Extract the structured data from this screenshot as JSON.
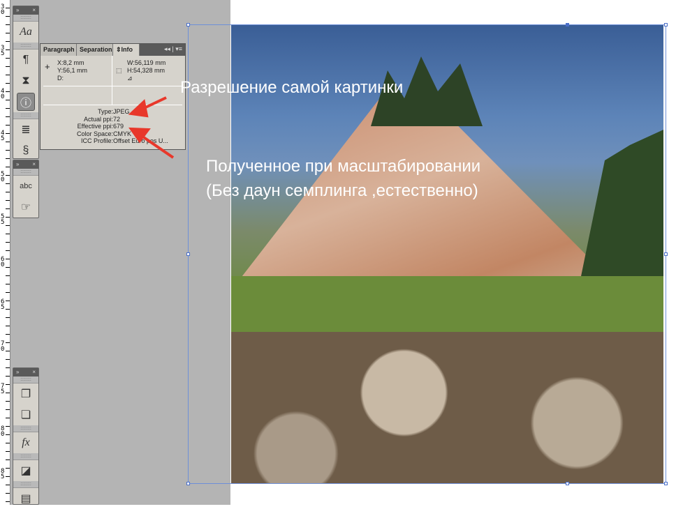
{
  "ruler": {
    "labels": [
      "3\n0",
      "3\n5",
      "4\n0",
      "4\n5",
      "5\n0",
      "5\n5",
      "6\n0",
      "6\n5",
      "7\n0",
      "7\n5",
      "8\n0",
      "8\n5"
    ]
  },
  "info_panel": {
    "tabs": [
      "Paragraph",
      "Separations",
      "Info"
    ],
    "x": "X:8,2 mm",
    "y": "Y:56,1 mm",
    "d": "D:",
    "w": "W:56,119 mm",
    "h": "H:54,328 mm",
    "props": [
      {
        "k": "Type:",
        "v": "JPEG"
      },
      {
        "k": "Actual ppi:",
        "v": "72"
      },
      {
        "k": "Effective ppi:",
        "v": "679"
      },
      {
        "k": "Color Space:",
        "v": "CMYK"
      },
      {
        "k": "ICC Profile:",
        "v": "Offset Euro pos U..."
      }
    ]
  },
  "annotations": {
    "note1": "Разрешение самой картинки",
    "note2_line1": "Полученное при масштабировании",
    "note2_line2": "(Без даун семплинга ,естественно)",
    "arrow_color": "#e8382b"
  }
}
